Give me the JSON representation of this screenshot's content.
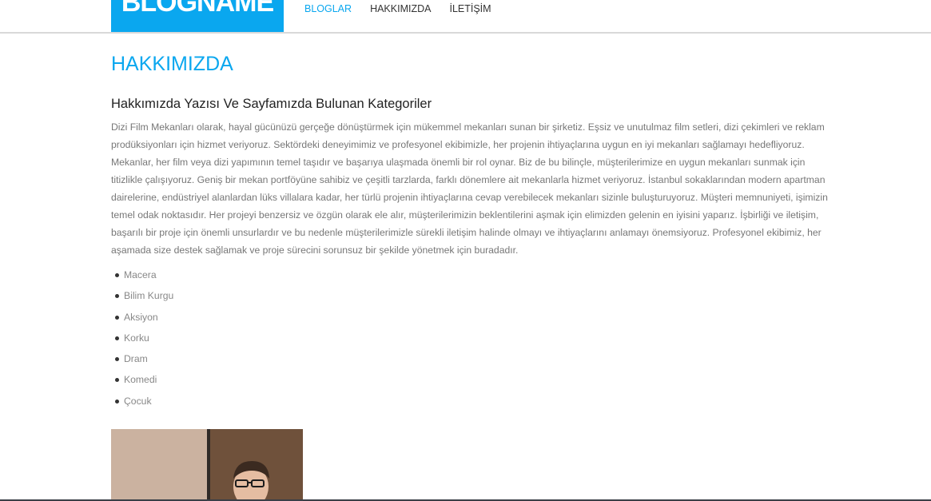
{
  "header": {
    "logo_text": "BLOGNAME",
    "nav": [
      {
        "label": "BLOGLAR",
        "active": true
      },
      {
        "label": "HAKKIMIZDA",
        "active": false
      },
      {
        "label": "İLETİŞİM",
        "active": false
      }
    ]
  },
  "main": {
    "page_title": "HAKKIMIZDA",
    "section_title": "Hakkımızda Yazısı Ve Sayfamızda Bulunan Kategoriler",
    "paragraph": "Dizi Film Mekanları olarak, hayal gücünüzü gerçeğe dönüştürmek için mükemmel mekanları sunan bir şirketiz. Eşsiz ve unutulmaz film setleri, dizi çekimleri ve reklam prodüksiyonları için hizmet veriyoruz. Sektördeki deneyimimiz ve profesyonel ekibimizle, her projenin ihtiyaçlarına uygun en iyi mekanları sağlamayı hedefliyoruz. Mekanlar, her film veya dizi yapımının temel taşıdır ve başarıya ulaşmada önemli bir rol oynar. Biz de bu bilinçle, müşterilerimize en uygun mekanları sunmak için titizlikle çalışıyoruz. Geniş bir mekan portföyüne sahibiz ve çeşitli tarzlarda, farklı dönemlere ait mekanlarla hizmet veriyoruz. İstanbul sokaklarından modern apartman dairelerine, endüstriyel alanlardan lüks villalara kadar, her türlü projenin ihtiyaçlarına cevap verebilecek mekanları sizinle buluşturuyoruz. Müşteri memnuniyeti, işimizin temel odak noktasıdır. Her projeyi benzersiz ve özgün olarak ele alır, müşterilerimizin beklentilerini aşmak için elimizden gelenin en iyisini yaparız. İşbirliği ve iletişim, başarılı bir proje için önemli unsurlardır ve bu nedenle müşterilerimizle sürekli iletişim halinde olmayı ve ihtiyaçlarını anlamayı önemsiyoruz. Profesyonel ekibimiz, her aşamada size destek sağlamak ve proje sürecini sorunsuz bir şekilde yönetmek için buradadır.",
    "categories": [
      "Macera",
      "Bilim Kurgu",
      "Aksiyon",
      "Korku",
      "Dram",
      "Komedi",
      "Çocuk"
    ]
  },
  "colors": {
    "accent": "#0aa7ef",
    "text": "#777777",
    "heading": "#222222"
  }
}
